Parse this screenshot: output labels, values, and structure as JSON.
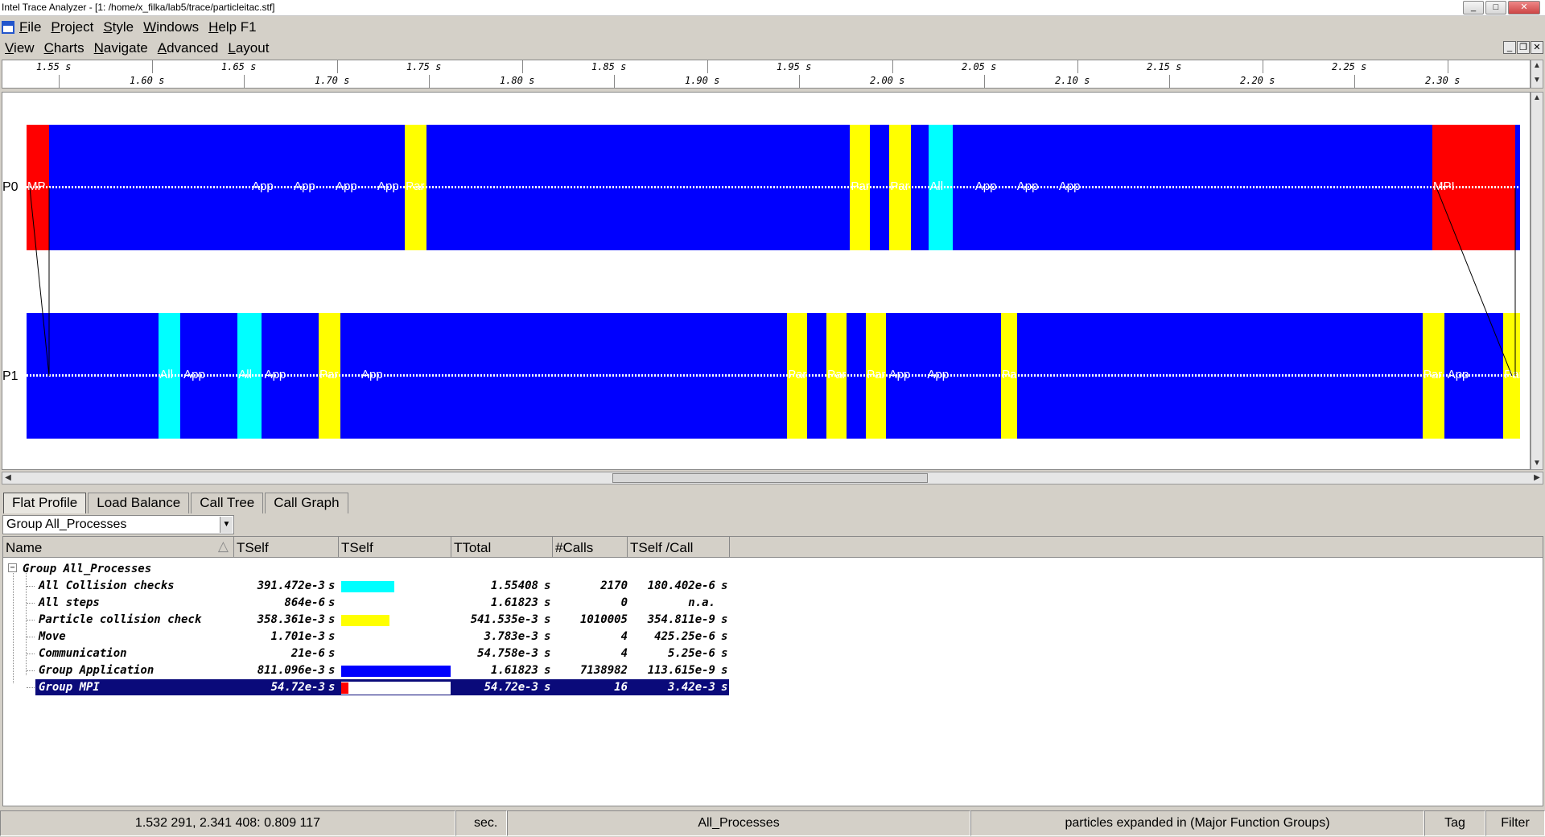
{
  "window": {
    "title": "Intel Trace Analyzer - [1: /home/x_filka/lab5/trace/particleitac.stf]"
  },
  "menu_main": [
    {
      "label": "File"
    },
    {
      "label": "Project"
    },
    {
      "label": "Style"
    },
    {
      "label": "Windows"
    },
    {
      "label": "Help F1"
    }
  ],
  "menu_chart": [
    {
      "label": "View"
    },
    {
      "label": "Charts"
    },
    {
      "label": "Navigate"
    },
    {
      "label": "Advanced"
    },
    {
      "label": "Layout"
    }
  ],
  "ruler": {
    "upper": [
      "1.55  s",
      "1.65  s",
      "1.75  s",
      "1.85  s",
      "1.95  s",
      "2.05  s",
      "2.15  s",
      "2.25  s"
    ],
    "lower": [
      "1.60  s",
      "1.70  s",
      "1.80  s",
      "1.90  s",
      "2.00  s",
      "2.10  s",
      "2.20  s",
      "2.30  s"
    ]
  },
  "timeline": {
    "colors": {
      "application": "#0000ff",
      "mpi": "#ff0000",
      "collision_check": "#ffff00",
      "all_collision": "#00ffff"
    },
    "processes": [
      {
        "label": "P0",
        "segments": [
          {
            "type": "mpi",
            "from": 0,
            "to": 0.0151,
            "text": "MP"
          },
          {
            "type": "application",
            "from": 0.0151,
            "to": 0.2533,
            "texts": [
              "App",
              "App",
              "App",
              "App",
              "App"
            ]
          },
          {
            "type": "collision_check",
            "from": 0.2533,
            "to": 0.2678,
            "text": "Par"
          },
          {
            "type": "application",
            "from": 0.2678,
            "to": 0.5514
          },
          {
            "type": "collision_check",
            "from": 0.5514,
            "to": 0.5646,
            "text": "Par"
          },
          {
            "type": "application",
            "from": 0.5646,
            "to": 0.5778
          },
          {
            "type": "collision_check",
            "from": 0.5778,
            "to": 0.5923,
            "text": "Par"
          },
          {
            "type": "application",
            "from": 0.5923,
            "to": 0.6042
          },
          {
            "type": "all_collision",
            "from": 0.6042,
            "to": 0.62,
            "text": "All"
          },
          {
            "type": "application",
            "from": 0.62,
            "to": 0.9413,
            "texts": [
              "App",
              "App",
              "App"
            ]
          },
          {
            "type": "mpi",
            "from": 0.9413,
            "to": 0.9967,
            "text": "MPI"
          },
          {
            "type": "application",
            "from": 0.9967,
            "to": 1
          }
        ]
      },
      {
        "label": "P1",
        "segments": [
          {
            "type": "application",
            "from": 0,
            "to": 0.0885
          },
          {
            "type": "all_collision",
            "from": 0.0885,
            "to": 0.103,
            "text": "All"
          },
          {
            "type": "application",
            "from": 0.103,
            "to": 0.1413,
            "texts": [
              "App"
            ]
          },
          {
            "type": "all_collision",
            "from": 0.1413,
            "to": 0.1571,
            "text": "All"
          },
          {
            "type": "application",
            "from": 0.1571,
            "to": 0.1956,
            "texts": [
              "App"
            ]
          },
          {
            "type": "collision_check",
            "from": 0.1956,
            "to": 0.2101,
            "text": "Par"
          },
          {
            "type": "application",
            "from": 0.2101,
            "to": 0.5092,
            "texts": [
              "App"
            ]
          },
          {
            "type": "collision_check",
            "from": 0.5092,
            "to": 0.5224,
            "text": "Par"
          },
          {
            "type": "application",
            "from": 0.5224,
            "to": 0.5356
          },
          {
            "type": "collision_check",
            "from": 0.5356,
            "to": 0.5488,
            "text": "Par"
          },
          {
            "type": "application",
            "from": 0.5488,
            "to": 0.562
          },
          {
            "type": "collision_check",
            "from": 0.562,
            "to": 0.5752,
            "text": "Par"
          },
          {
            "type": "application",
            "from": 0.5752,
            "to": 0.6525,
            "texts": [
              "App",
              "App"
            ]
          },
          {
            "type": "collision_check",
            "from": 0.6525,
            "to": 0.6631,
            "text": "Pa"
          },
          {
            "type": "application",
            "from": 0.6631,
            "to": 0.9347
          },
          {
            "type": "collision_check",
            "from": 0.9347,
            "to": 0.9492,
            "text": "Par"
          },
          {
            "type": "application",
            "from": 0.9492,
            "to": 0.9888,
            "texts": [
              "App"
            ]
          },
          {
            "type": "collision_check",
            "from": 0.9888,
            "to": 1,
            "text": "Par"
          }
        ]
      }
    ]
  },
  "tabs": [
    {
      "label": "Flat Profile",
      "active": true
    },
    {
      "label": "Load Balance"
    },
    {
      "label": "Call Tree"
    },
    {
      "label": "Call Graph"
    }
  ],
  "group_select": {
    "value": "Group All_Processes"
  },
  "profile": {
    "columns": [
      "Name",
      "TSelf",
      "TSelf",
      "TTotal",
      "#Calls",
      "TSelf /Call"
    ],
    "group_label": "Group All_Processes",
    "rows": [
      {
        "name": "All Collision checks",
        "tself": "391.472e-3",
        "unit": "s",
        "bar_color": "#00ffff",
        "bar_fraction": 0.4826,
        "ttotal": "1.55408",
        "ttotal_unit": "s",
        "calls": "2170",
        "per_call": "180.402e-6",
        "per_call_unit": "s"
      },
      {
        "name": "All steps",
        "tself": "864e-6",
        "unit": "s",
        "bar_color": "",
        "bar_fraction": 0,
        "ttotal": "1.61823",
        "ttotal_unit": "s",
        "calls": "0",
        "per_call": "n.a.",
        "per_call_unit": ""
      },
      {
        "name": "Particle collision check",
        "tself": "358.361e-3",
        "unit": "s",
        "bar_color": "#ffff00",
        "bar_fraction": 0.4418,
        "ttotal": "541.535e-3",
        "ttotal_unit": "s",
        "calls": "1010005",
        "per_call": "354.811e-9",
        "per_call_unit": "s"
      },
      {
        "name": "Move",
        "tself": "1.701e-3",
        "unit": "s",
        "bar_color": "",
        "bar_fraction": 0,
        "ttotal": "3.783e-3",
        "ttotal_unit": "s",
        "calls": "4",
        "per_call": "425.25e-6",
        "per_call_unit": "s"
      },
      {
        "name": "Communication",
        "tself": "21e-6",
        "unit": "s",
        "bar_color": "",
        "bar_fraction": 0,
        "ttotal": "54.758e-3",
        "ttotal_unit": "s",
        "calls": "4",
        "per_call": "5.25e-6",
        "per_call_unit": "s"
      },
      {
        "name": "Group Application",
        "tself": "811.096e-3",
        "unit": "s",
        "bar_color": "#0000ff",
        "bar_fraction": 1.0,
        "ttotal": "1.61823",
        "ttotal_unit": "s",
        "calls": "7138982",
        "per_call": "113.615e-9",
        "per_call_unit": "s"
      },
      {
        "name": "Group MPI",
        "tself": "54.72e-3",
        "unit": "s",
        "bar_color": "#ff0000",
        "bar_fraction": 0.0675,
        "ttotal": "54.72e-3",
        "ttotal_unit": "s",
        "calls": "16",
        "per_call": "3.42e-3",
        "per_call_unit": "s",
        "selected": true
      }
    ]
  },
  "status": {
    "range": "1.532 291, 2.341 408: 0.809 117",
    "unit": "sec.",
    "group": "All_Processes",
    "expanded": "particles expanded in (Major Function Groups)",
    "tag": "Tag",
    "filter": "Filter"
  }
}
